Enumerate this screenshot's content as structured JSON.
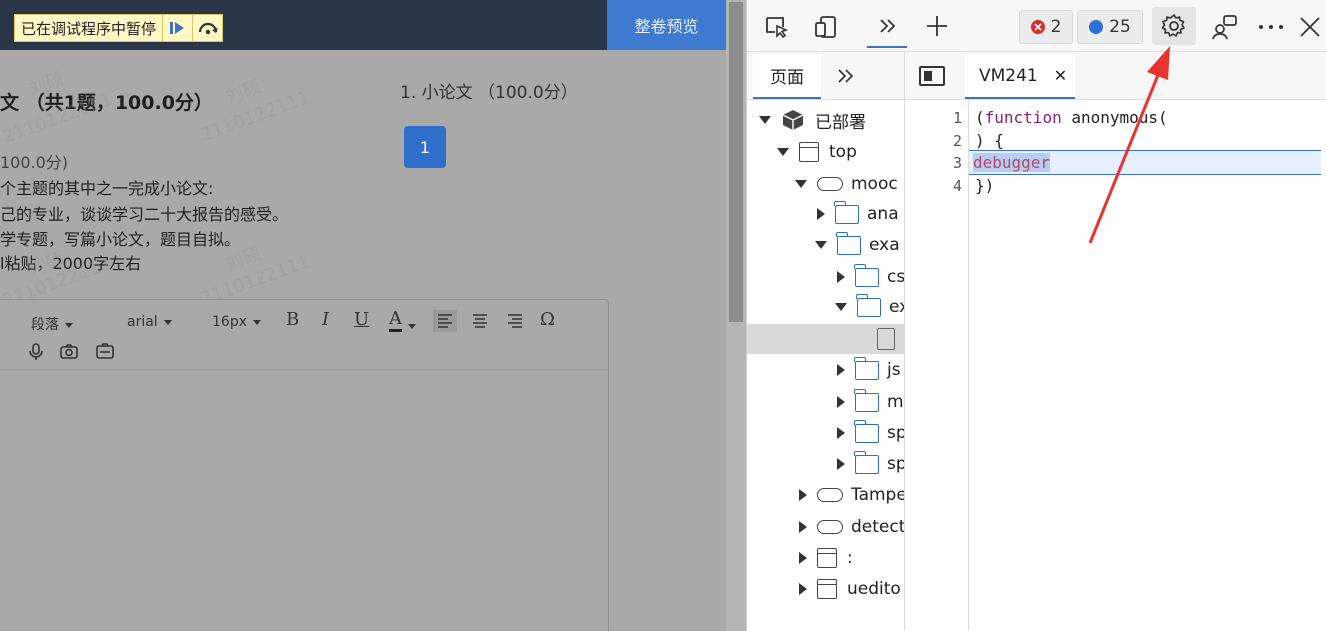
{
  "page": {
    "paused_banner": "已在调试程序中暂停",
    "preview_button": "整卷预览",
    "section_title": "文 （共1题，100.0分）",
    "question_nav_title": "1. 小论文 （100.0分）",
    "question_number": "1",
    "question_score": "100.0分)",
    "question_lines": [
      "个主题的其中之一完成小论文:",
      "己的专业，谈谈学习二十大报告的感受。",
      "学专题，写篇小论文，题目自拟。",
      "l粘贴，2000字左右"
    ],
    "watermark_name": "刘硕",
    "watermark_id": "2110122111",
    "toolbar": {
      "paragraph": "段落",
      "font": "arial",
      "size": "16px",
      "bold": "B",
      "italic": "I",
      "underline": "U",
      "font_color": "A",
      "omega": "Ω"
    }
  },
  "devtools": {
    "error_count": "2",
    "message_count": "25",
    "nav_tab": "页面",
    "source_tab": "VM241",
    "tree": {
      "deployed": "已部署",
      "top": "top",
      "mooc": "mooc",
      "ana": "ana",
      "exa": "exa",
      "cs": "cs",
      "ex": "ex",
      "js": "js",
      "m": "m",
      "sp1": "sp",
      "sp2": "sp",
      "tampe": "Tampe",
      "detect": "detect",
      "colon": ":",
      "uedito": "uedito"
    },
    "code_lines": [
      "(function anonymous(",
      ") {",
      "debugger",
      "})"
    ],
    "line_numbers": [
      "1",
      "2",
      "3",
      "4"
    ]
  },
  "colors": {
    "page_overlay": "#a9a9a9",
    "top_bar": "#2b3548",
    "preview_button": "#3f7ad1",
    "accent": "#3b73c9",
    "annotation_arrow": "#e8332f"
  }
}
